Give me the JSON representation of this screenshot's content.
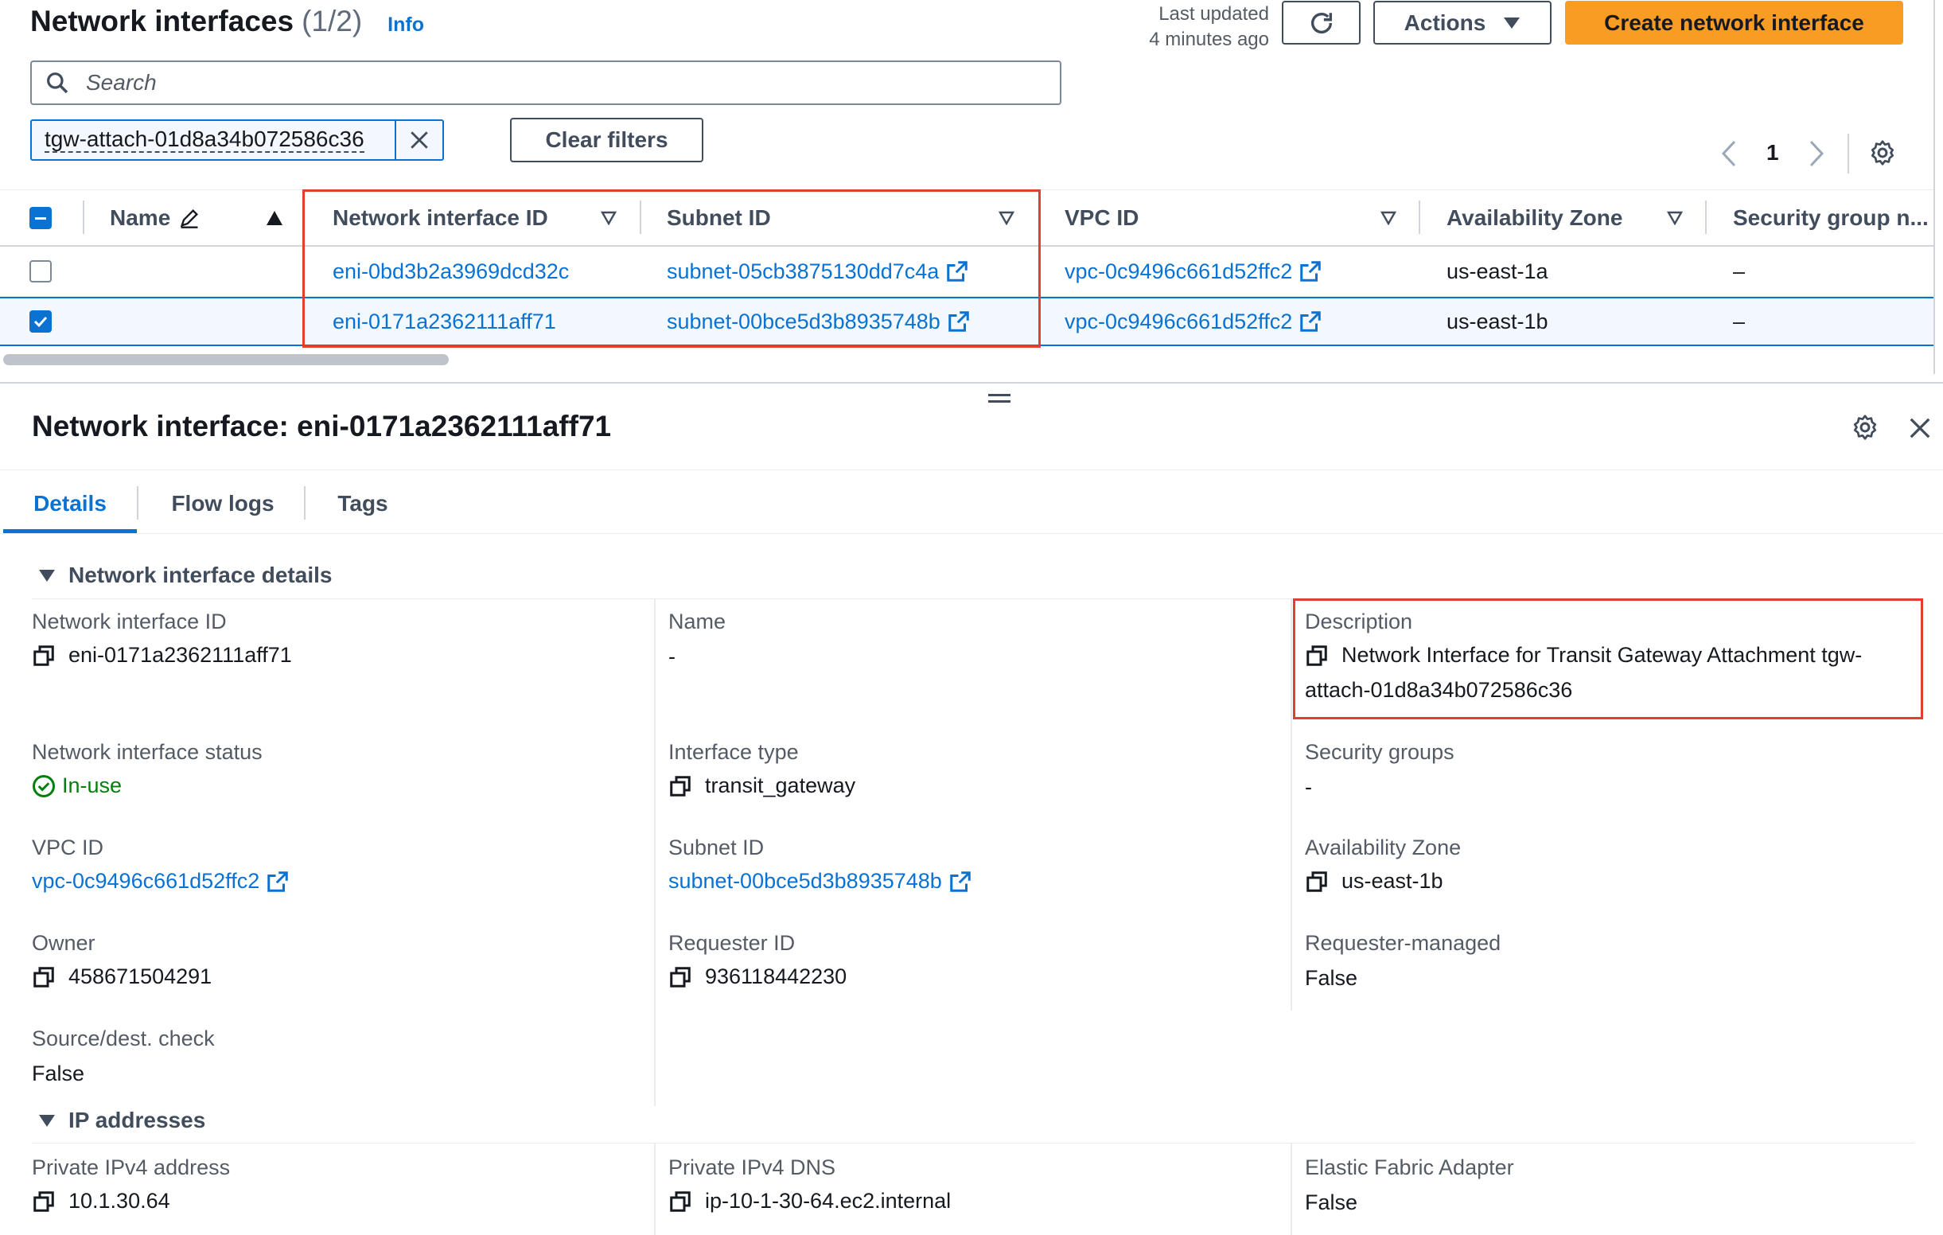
{
  "header": {
    "title": "Network interfaces",
    "count": "(1/2)",
    "info": "Info",
    "last_updated_line1": "Last updated",
    "last_updated_line2": "4 minutes ago",
    "actions_label": "Actions",
    "create_label": "Create network interface"
  },
  "search": {
    "placeholder": "Search"
  },
  "filter": {
    "token": "tgw-attach-01d8a34b072586c36",
    "clear_label": "Clear filters"
  },
  "pagination": {
    "page": "1"
  },
  "table": {
    "columns": [
      "Name",
      "Network interface ID",
      "Subnet ID",
      "VPC ID",
      "Availability Zone",
      "Security group n..."
    ],
    "rows": [
      {
        "checked": false,
        "name": "",
        "eni": "eni-0bd3b2a3969dcd32c",
        "subnet": "subnet-05cb3875130dd7c4a",
        "vpc": "vpc-0c9496c661d52ffc2",
        "az": "us-east-1a",
        "sg": "–"
      },
      {
        "checked": true,
        "name": "",
        "eni": "eni-0171a2362111aff71",
        "subnet": "subnet-00bce5d3b8935748b",
        "vpc": "vpc-0c9496c661d52ffc2",
        "az": "us-east-1b",
        "sg": "–"
      }
    ]
  },
  "detail": {
    "title": "Network interface: eni-0171a2362111aff71",
    "tabs": [
      "Details",
      "Flow logs",
      "Tags"
    ],
    "section1_title": "Network interface details",
    "fields": {
      "eni_label": "Network interface ID",
      "eni_value": "eni-0171a2362111aff71",
      "name_label": "Name",
      "name_value": "-",
      "desc_label": "Description",
      "desc_line1": "Network Interface for Transit Gateway Attachment tgw-",
      "desc_line2": "attach-01d8a34b072586c36",
      "status_label": "Network interface status",
      "status_value": "In-use",
      "type_label": "Interface type",
      "type_value": "transit_gateway",
      "sg_label": "Security groups",
      "sg_value": "-",
      "vpc_label": "VPC ID",
      "vpc_value": "vpc-0c9496c661d52ffc2",
      "subnet_label": "Subnet ID",
      "subnet_value": "subnet-00bce5d3b8935748b",
      "az_label": "Availability Zone",
      "az_value": "us-east-1b",
      "owner_label": "Owner",
      "owner_value": "458671504291",
      "requester_label": "Requester ID",
      "requester_value": "936118442230",
      "reqmanaged_label": "Requester-managed",
      "reqmanaged_value": "False",
      "srcdest_label": "Source/dest. check",
      "srcdest_value": "False"
    },
    "section2_title": "IP addresses",
    "ip": {
      "ipv4_label": "Private IPv4 address",
      "ipv4_value": "10.1.30.64",
      "dns_label": "Private IPv4 DNS",
      "dns_value": "ip-10-1-30-64.ec2.internal",
      "efa_label": "Elastic Fabric Adapter",
      "efa_value": "False"
    }
  },
  "colors": {
    "accent": "#0972d3",
    "primary_button": "#f89c24",
    "highlight": "#e0402f",
    "success": "#037f0c"
  }
}
